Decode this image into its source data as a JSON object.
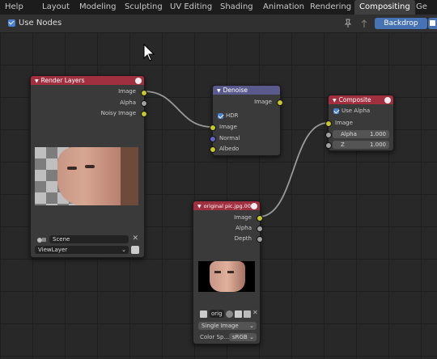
{
  "topbar": {
    "help": "Help",
    "tabs": [
      "Layout",
      "Modeling",
      "Sculpting",
      "UV Editing",
      "Shading",
      "Animation",
      "Rendering",
      "Compositing",
      "Ge"
    ],
    "active_tab": "Compositing"
  },
  "header": {
    "use_nodes": "Use Nodes",
    "backdrop": "Backdrop"
  },
  "render_layers": {
    "title": "Render Layers",
    "outputs": [
      "Image",
      "Alpha",
      "Noisy Image"
    ],
    "scene": "Scene",
    "view_layer": "ViewLayer"
  },
  "denoise": {
    "title": "Denoise",
    "output": "Image",
    "hdr": "HDR",
    "inputs": [
      "Image",
      "Normal",
      "Albedo"
    ]
  },
  "composite": {
    "title": "Composite",
    "use_alpha": "Use Alpha",
    "image": "Image",
    "alpha_label": "Alpha",
    "alpha_value": "1.000",
    "z_label": "Z",
    "z_value": "1.000"
  },
  "image_node": {
    "title": "original pic.jpg.001",
    "outputs": [
      "Image",
      "Alpha",
      "Depth"
    ],
    "image_name": "orig",
    "source": "Single Image",
    "color_space_label": "Color Sp...",
    "color_space": "sRGB"
  },
  "colors": {
    "accent": "#4a7fd1",
    "node_red": "#a03040",
    "node_purple": "#5a5a8c",
    "socket_yellow": "#c7c729"
  }
}
